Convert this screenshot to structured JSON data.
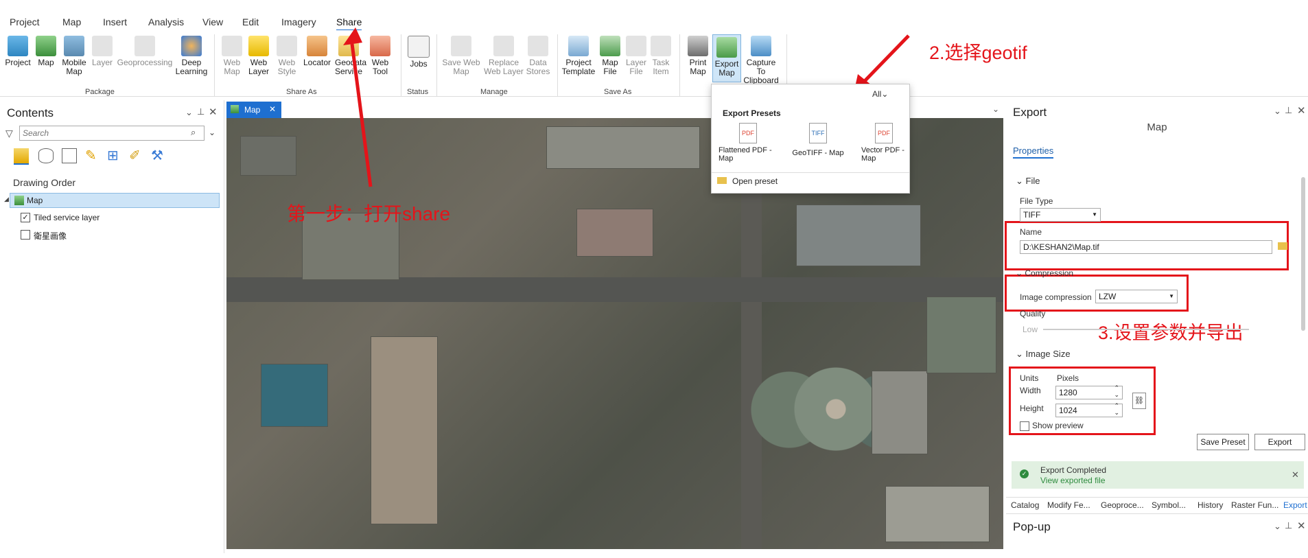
{
  "menu_tabs": [
    "Project",
    "Map",
    "Insert",
    "Analysis",
    "View",
    "Edit",
    "Imagery",
    "Share"
  ],
  "ribbon": {
    "package": {
      "group": "Package",
      "buttons": [
        "Project",
        "Map",
        "Mobile Map",
        "Layer",
        "Geoprocessing",
        "Deep Learning"
      ]
    },
    "share_as": {
      "group": "Share As",
      "buttons": [
        "Web Map",
        "Web Layer",
        "Web Style",
        "Locator",
        "Geodata Service",
        "Web Tool"
      ]
    },
    "status": {
      "group": "Status",
      "buttons": [
        "Jobs"
      ]
    },
    "manage": {
      "group": "Manage",
      "buttons": [
        "Save Web Map",
        "Replace Web Layer",
        "Data Stores"
      ]
    },
    "save_as": {
      "group": "Save As",
      "buttons": [
        "Project Template",
        "Map File",
        "Layer File",
        "Task Item"
      ]
    },
    "output": {
      "buttons": [
        "Print Map",
        "Export Map",
        "Capture To Clipboard"
      ]
    }
  },
  "export_dropdown": {
    "filter": "All",
    "heading": "Export Presets",
    "presets": [
      "Flattened PDF - Map",
      "GeoTIFF - Map",
      "Vector PDF - Map"
    ],
    "open_preset": "Open preset"
  },
  "contents": {
    "title": "Contents",
    "search_placeholder": "Search",
    "drawing_order": "Drawing Order",
    "map_item": "Map",
    "layers": [
      {
        "name": "Tiled service layer",
        "checked": true
      },
      {
        "name": "衛星画像",
        "checked": false
      }
    ]
  },
  "map_view": {
    "tab": "Map"
  },
  "annotations": {
    "step1": "第一步：打开share",
    "step2": "2.选择geotif",
    "step3": "3.设置参数并导出"
  },
  "export_pane": {
    "title": "Export",
    "subtitle": "Map",
    "properties_tab": "Properties",
    "file_section": "File",
    "file_type_label": "File Type",
    "file_type": "TIFF",
    "name_label": "Name",
    "name_value": "D:\\KESHAN2\\Map.tif",
    "compression_section": "Compression",
    "image_compression_label": "Image compression",
    "image_compression": "LZW",
    "quality_label": "Quality",
    "quality_low": "Low",
    "image_size_section": "Image Size",
    "units_label": "Units",
    "units_value": "Pixels",
    "width_label": "Width",
    "width_value": "1280",
    "height_label": "Height",
    "height_value": "1024",
    "show_preview": "Show preview",
    "save_preset": "Save Preset",
    "export_button": "Export",
    "completed_title": "Export Completed",
    "completed_link": "View exported file"
  },
  "bottom_tabs": [
    "Catalog",
    "Modify Fe...",
    "Geoproce...",
    "Symbol...",
    "History",
    "Raster Fun...",
    "Export"
  ],
  "popup_pane": {
    "title": "Pop-up"
  },
  "colors": {
    "accent": "#1e6fd0",
    "annotation_red": "#e4141a",
    "selection": "#cde4f7"
  }
}
